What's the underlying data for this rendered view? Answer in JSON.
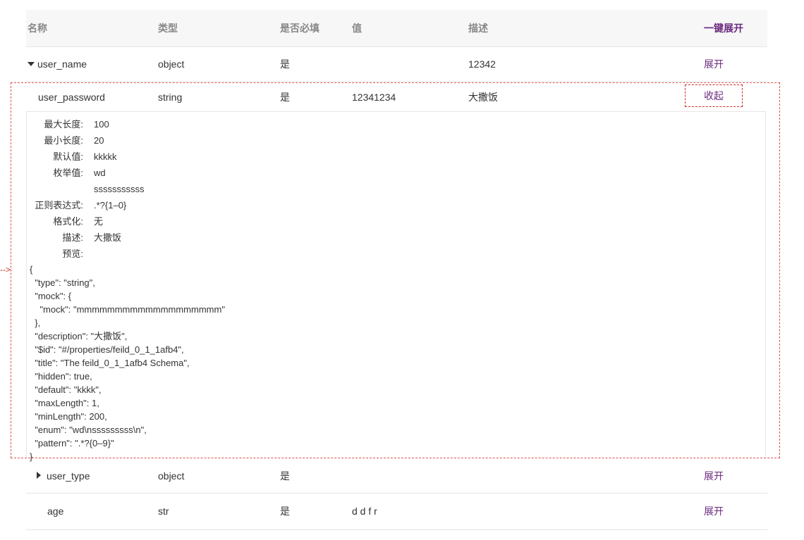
{
  "header": {
    "name": "名称",
    "type": "类型",
    "required": "是否必填",
    "value": "值",
    "description": "描述",
    "expand_all": "一键展开"
  },
  "rows": [
    {
      "name": "user_name",
      "type": "object",
      "required": "是",
      "value": "",
      "description": "12342",
      "action": "展开"
    },
    {
      "name": "user_password",
      "type": "string",
      "required": "是",
      "value": "12341234",
      "description": "大撒饭",
      "action": "收起"
    },
    {
      "name": "user_type",
      "type": "object",
      "required": "是",
      "value": "",
      "description": "",
      "action": "展开"
    },
    {
      "name": "age",
      "type": "str",
      "required": "是",
      "value": "d d f r",
      "description": "",
      "action": "展开"
    }
  ],
  "detail": {
    "max_length_label": "最大长度:",
    "max_length": "100",
    "min_length_label": "最小长度:",
    "min_length": "20",
    "default_label": "默认值:",
    "default": "kkkkk",
    "enum_label": "枚举值:",
    "enum_1": "wd",
    "enum_2": "sssssssssss",
    "pattern_label": "正则表达式:",
    "pattern": ".*?{1–0}",
    "format_label": "格式化:",
    "format": "无",
    "desc_label": "描述:",
    "desc": "大撒饭",
    "preview_label": "预览:",
    "json": "{\n  \"type\": \"string\",\n  \"mock\": {\n    \"mock\": \"mmmmmmmmmmmmmmmmmmm\"\n  },\n  \"description\": \"大撒饭\",\n  \"$id\": \"#/properties/feild_0_1_1afb4\",\n  \"title\": \"The feild_0_1_1afb4 Schema\",\n  \"hidden\": true,\n  \"default\": \"kkkk\",\n  \"maxLength\": 1,\n  \"minLength\": 200,\n  \"enum\": \"wd\\nsssssssss\\n\",\n  \"pattern\": \".*?{0–9}\"\n}"
  },
  "colors": {
    "accent": "#6b2b80",
    "selection": "#d9534f"
  }
}
